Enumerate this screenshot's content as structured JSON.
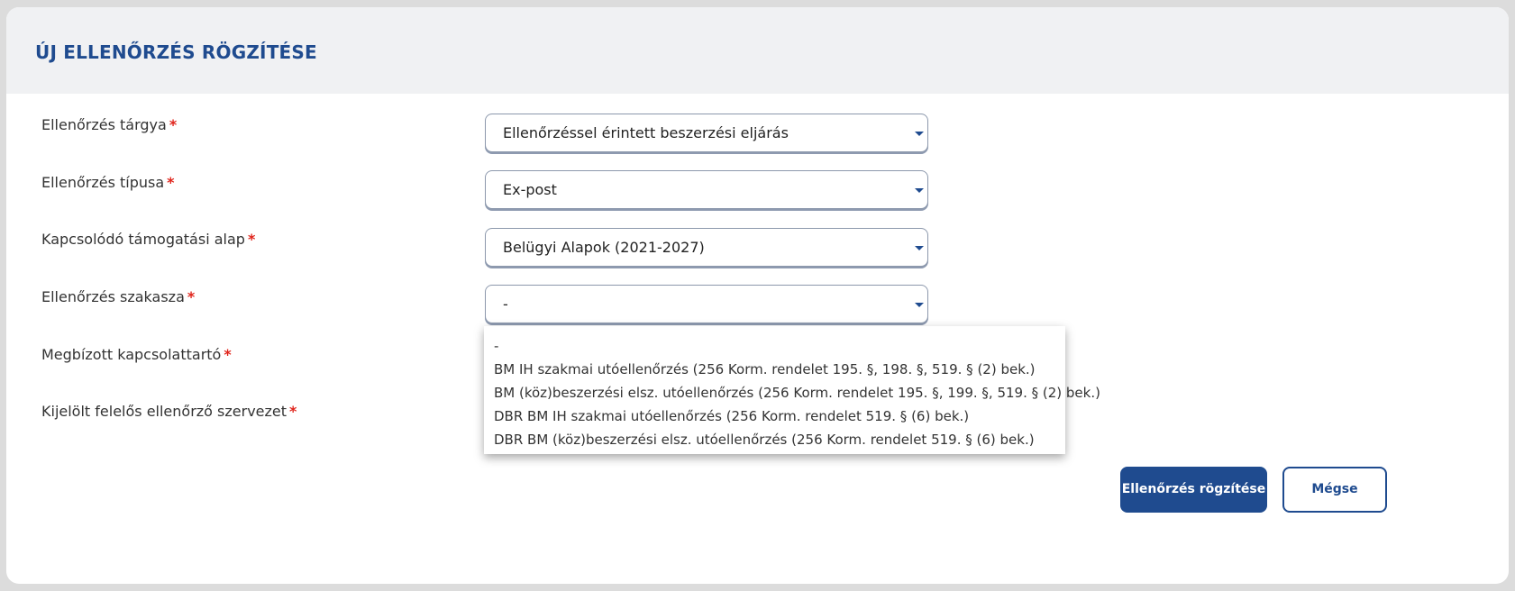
{
  "header": {
    "title": "ÚJ ELLENŐRZÉS RÖGZÍTÉSE"
  },
  "form": {
    "required_marker": "*",
    "fields": [
      {
        "label": "Ellenőrzés tárgya",
        "value": "Ellenőrzéssel érintett beszerzési eljárás"
      },
      {
        "label": "Ellenőrzés típusa",
        "value": "Ex-post"
      },
      {
        "label": "Kapcsolódó támogatási alap",
        "value": "Belügyi Alapok (2021-2027)"
      },
      {
        "label": "Ellenőrzés szakasza",
        "value": "-"
      },
      {
        "label": "Megbízott kapcsolattartó"
      },
      {
        "label": "Kijelölt felelős ellenőrző szervezet"
      }
    ]
  },
  "dropdown": {
    "options": [
      "-",
      "BM IH szakmai utóellenőrzés (256 Korm. rendelet 195. §, 198. §, 519. § (2) bek.)",
      "BM (köz)beszerzési elsz. utóellenőrzés (256 Korm. rendelet 195. §, 199. §, 519. § (2) bek.)",
      "DBR BM IH szakmai utóellenőrzés (256 Korm. rendelet 519. § (6) bek.)",
      "DBR BM (köz)beszerzési elsz. utóellenőrzés (256 Korm. rendelet 519. § (6) bek.)"
    ]
  },
  "actions": {
    "submit_label": "Ellenőrzés rögzítése",
    "cancel_label": "Mégse"
  },
  "colors": {
    "accent": "#1f4b8f",
    "required": "#e0241b",
    "header_bg": "#f0f1f3"
  }
}
